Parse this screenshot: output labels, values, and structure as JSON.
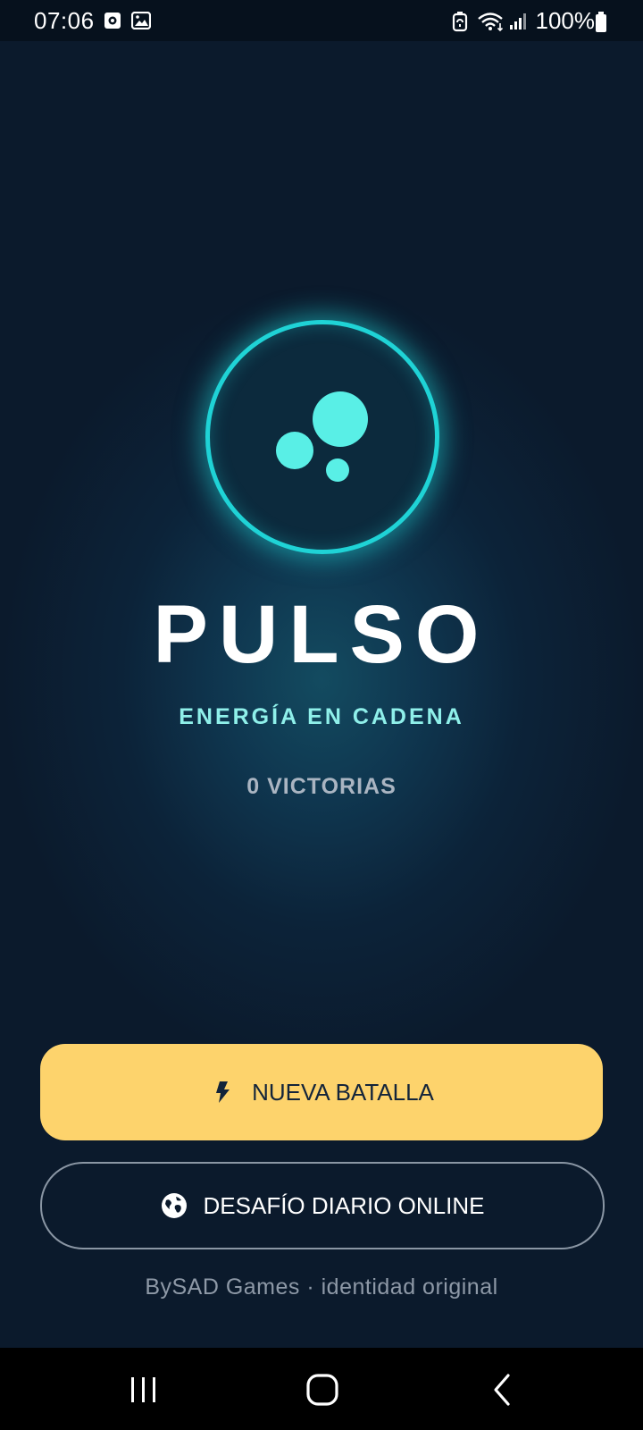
{
  "status_bar": {
    "time": "07:06",
    "battery": "100%",
    "icons": [
      "notification-icon",
      "gallery-icon",
      "battery-saver-icon",
      "wifi-icon",
      "signal-icon",
      "battery-icon"
    ]
  },
  "app": {
    "title": "PULSO",
    "subtitle": "ENERGÍA EN CADENA",
    "victories": "0 VICTORIAS",
    "logo_icon": "pulse-bubbles-icon"
  },
  "actions": {
    "new_battle": {
      "label": "NUEVA BATALLA",
      "icon": "bolt-icon"
    },
    "daily_challenge": {
      "label": "DESAFÍO DIARIO ONLINE",
      "icon": "globe-icon"
    }
  },
  "footer": {
    "text": "BySAD Games · identidad original"
  },
  "navigation": {
    "buttons": [
      "recent-apps-icon",
      "home-icon",
      "back-icon"
    ]
  },
  "colors": {
    "background": "#0b1a2c",
    "accent_cyan": "#1fd3d6",
    "dots": "#59efe6",
    "primary_button": "#fdd36c",
    "subtitle": "#8ff0ea"
  }
}
